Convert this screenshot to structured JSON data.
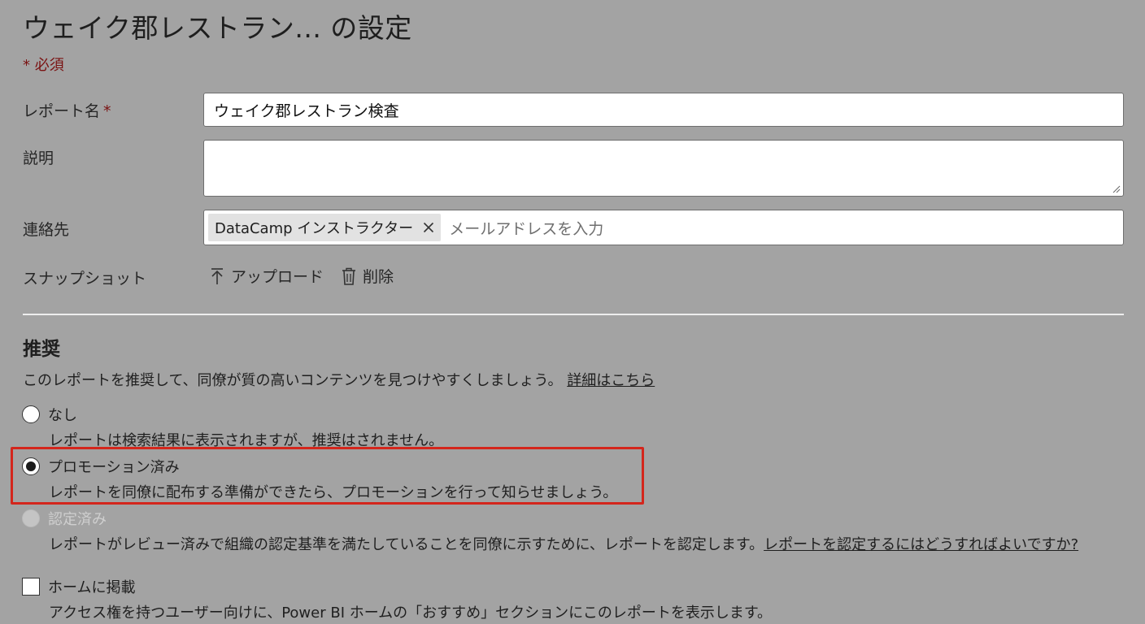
{
  "page": {
    "title": "ウェイク郡レストラン... の設定",
    "required_note": "* 必須"
  },
  "form": {
    "report_name": {
      "label": "レポート名",
      "required_mark": "*",
      "value": "ウェイク郡レストラン検査"
    },
    "description": {
      "label": "説明",
      "value": ""
    },
    "contact": {
      "label": "連絡先",
      "chip_label": "DataCamp インストラクター",
      "placeholder": "メールアドレスを入力"
    },
    "snapshot": {
      "label": "スナップショット",
      "upload_label": "アップロード",
      "delete_label": "削除"
    }
  },
  "endorsement": {
    "title": "推奨",
    "description": "このレポートを推奨して、同僚が質の高いコンテンツを見つけやすくしましょう。",
    "learn_more_link": "詳細はこちら",
    "options": [
      {
        "label": "なし",
        "description": "レポートは検索結果に表示されますが、推奨はされません。",
        "selected": false,
        "disabled": false
      },
      {
        "label": "プロモーション済み",
        "description": "レポートを同僚に配布する準備ができたら、プロモーションを行って知らせましょう。",
        "selected": true,
        "disabled": false
      },
      {
        "label": "認定済み",
        "description": "レポートがレビュー済みで組織の認定基準を満たしていることを同僚に示すために、レポートを認定します。",
        "link": "レポートを認定するにはどうすればよいですか?",
        "selected": false,
        "disabled": true
      }
    ],
    "feature_home": {
      "label": "ホームに掲載",
      "description": "アクセス権を持つユーザー向けに、Power BI ホームの「おすすめ」セクションにこのレポートを表示します。",
      "checked": false
    }
  },
  "colors": {
    "background": "#a3a3a3",
    "highlight_border": "#d4261c",
    "required": "#7a1212"
  }
}
